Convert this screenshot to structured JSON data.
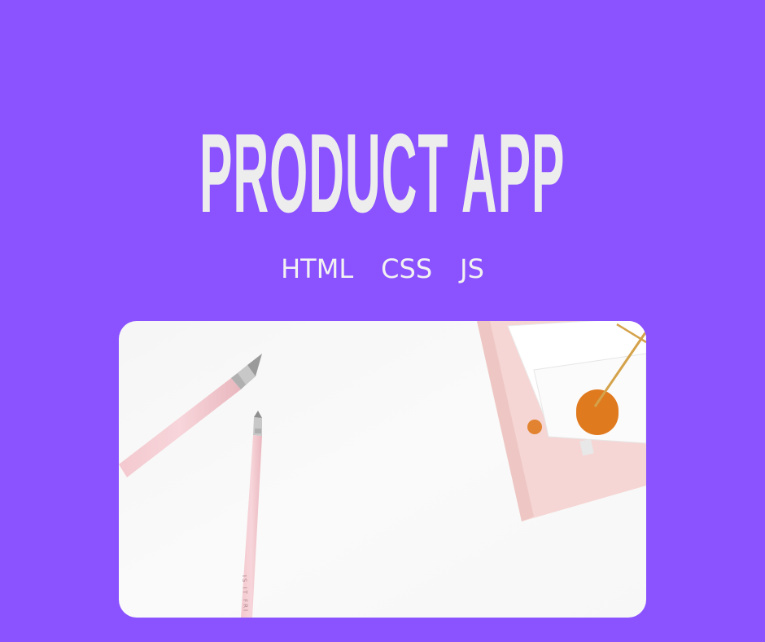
{
  "background_color": "#8B52FF",
  "title": "PRODUCT APP",
  "title_color": "#EDEDED",
  "tech_tags": [
    "HTML",
    "CSS",
    "JS"
  ],
  "photo": {
    "icon": "desk-pens-notebook-photo",
    "pencil_imprint": "IS IT FRI"
  }
}
